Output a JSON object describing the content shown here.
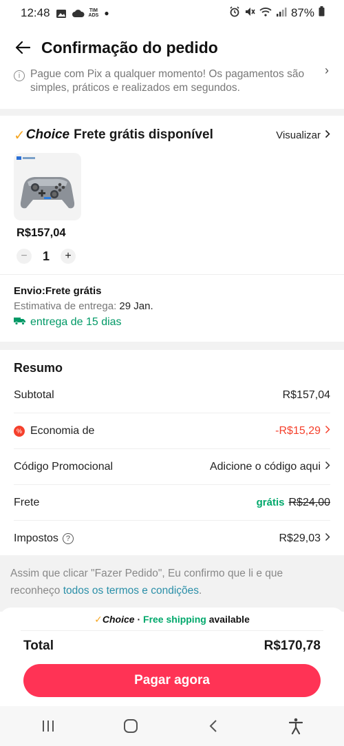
{
  "status_bar": {
    "time": "12:48",
    "carrier_line1": "TIM",
    "carrier_line2": "ADS",
    "battery": "87%"
  },
  "header": {
    "title": "Confirmação do pedido"
  },
  "pix_note": {
    "text": "Pague com Pix a qualquer momento! Os pagamentos são simples, práticos e realizados em segundos."
  },
  "choice_section": {
    "brand": "Choice",
    "title": "Frete grátis disponível",
    "view_label": "Visualizar",
    "product": {
      "price": "R$157,04",
      "quantity": "1",
      "minus": "−",
      "plus": "+"
    }
  },
  "shipping": {
    "title": "Envio:Frete grátis",
    "estimate_label": "Estimativa de entrega:",
    "estimate_date": "29 Jan.",
    "days": "entrega de 15 dias"
  },
  "summary": {
    "title": "Resumo",
    "subtotal_label": "Subtotal",
    "subtotal_value": "R$157,04",
    "savings_label": "Economia de",
    "savings_value": "-R$15,29",
    "promo_label": "Código Promocional",
    "promo_value": "Adicione o código aqui",
    "shipping_label": "Frete",
    "shipping_free": "grátis",
    "shipping_old": "R$24,00",
    "tax_label": "Impostos",
    "tax_value": "R$29,03"
  },
  "terms": {
    "text": "Assim que clicar \"Fazer Pedido\", Eu confirmo que li e que reconheço ",
    "link": "todos os termos e condições",
    "end": "."
  },
  "bottom": {
    "brand": "Choice",
    "separator": "·",
    "free_shipping": "Free shipping",
    "available": "available",
    "total_label": "Total",
    "total_value": "R$170,78",
    "pay_button": "Pagar agora"
  },
  "colors": {
    "accent": "#ff3355",
    "green": "#00a86b",
    "red": "#f5402c",
    "choice_gold": "#f5a623"
  }
}
